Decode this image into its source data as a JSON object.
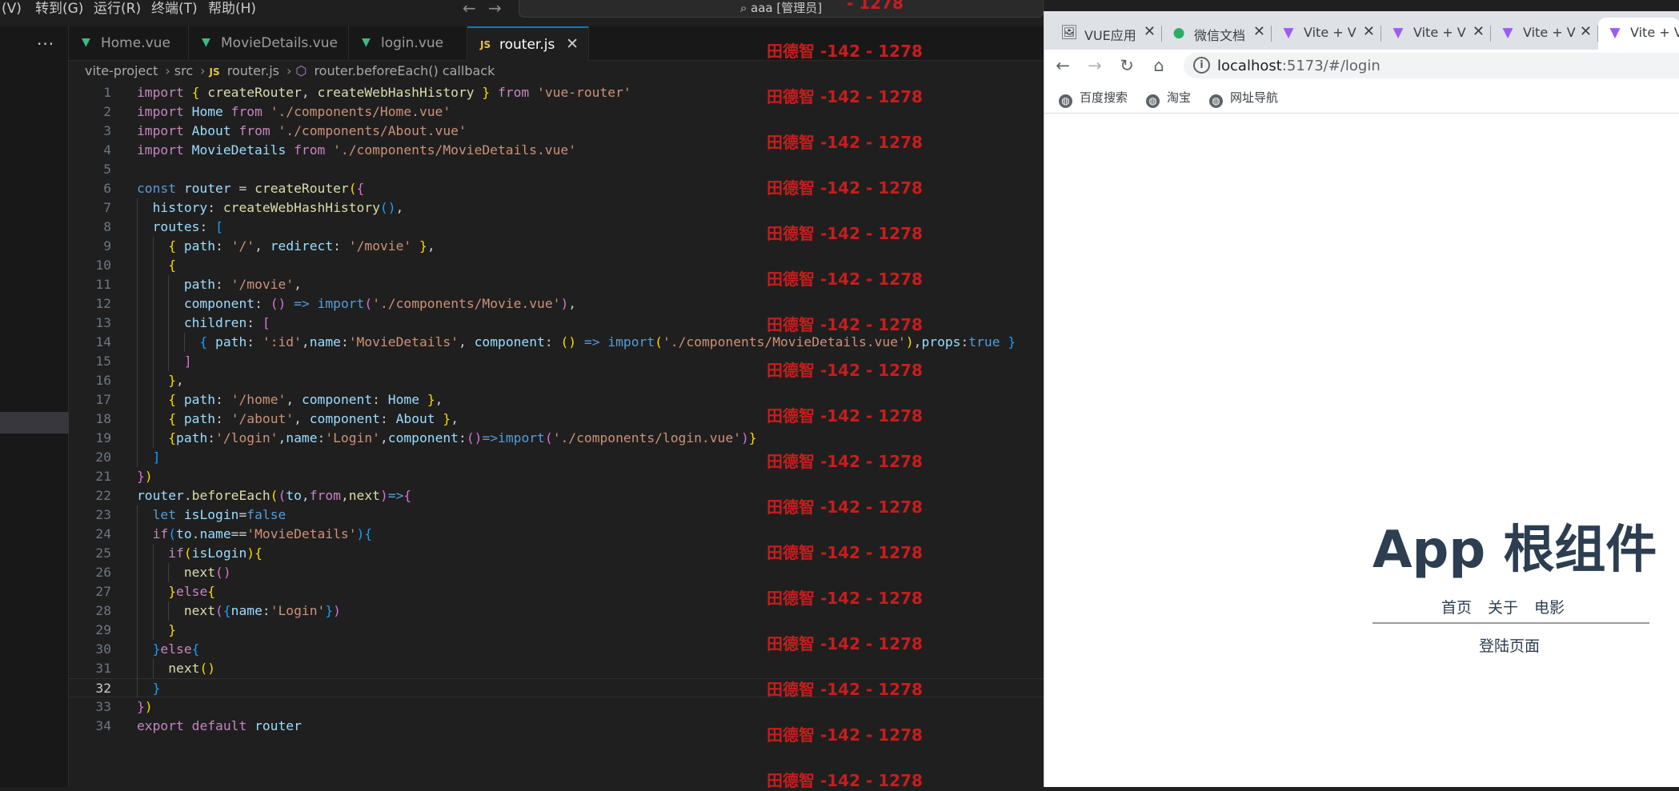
{
  "titlebar": {
    "menus": [
      "(V)",
      "转到(G)",
      "运行(R)",
      "终端(T)",
      "帮助(H)"
    ],
    "back_arrow": "←",
    "forward_arrow": "→",
    "command_center": "aaa [管理员]"
  },
  "sidebar": {
    "more": "···"
  },
  "editor_tabs": [
    {
      "label": "Home.vue",
      "icon": "vue-icon",
      "active": false
    },
    {
      "label": "MovieDetails.vue",
      "icon": "vue-icon",
      "active": false
    },
    {
      "label": "login.vue",
      "icon": "vue-icon",
      "active": false
    },
    {
      "label": "router.js",
      "icon": "js-icon",
      "active": true
    }
  ],
  "tab_icons": {
    "vue": "▼",
    "js": "JS",
    "close": "✕"
  },
  "breadcrumb": {
    "project": "vite-project",
    "folder": "src",
    "file": "router.js",
    "symbol": "router.beforeEach() callback",
    "separator": "›"
  },
  "code": {
    "current_line": 32,
    "lines": [
      "import { createRouter, createWebHashHistory } from 'vue-router'",
      "import Home from './components/Home.vue'",
      "import About from './components/About.vue'",
      "import MovieDetails from './components/MovieDetails.vue'",
      "",
      "const router = createRouter({",
      "  history: createWebHashHistory(),",
      "  routes: [",
      "    { path: '/', redirect: '/movie' },",
      "    {",
      "      path: '/movie',",
      "      component: () => import('./components/Movie.vue'),",
      "      children: [",
      "        { path: ':id',name:'MovieDetails', component: () => import('./components/MovieDetails.vue'),props:true }",
      "      ]",
      "    },",
      "    { path: '/home', component: Home },",
      "    { path: '/about', component: About },",
      "    {path:'/login',name:'Login',component:()=>import('./components/login.vue')}",
      "  ]",
      "})",
      "router.beforeEach((to,from,next)=>{",
      "  let isLogin=false",
      "  if(to.name=='MovieDetails'){",
      "    if(isLogin){",
      "      next()",
      "    }else{",
      "      next({name:'Login'})",
      "    }",
      "  }else{",
      "    next()",
      "  }",
      "})",
      "export default router"
    ]
  },
  "watermark": {
    "text": "田德智 -142 - 1278",
    "top_partial": "- 1278",
    "count": 17,
    "color": "#c81d1d"
  },
  "browser": {
    "tabs": [
      {
        "label": "VUE应用",
        "icon": "picture-icon"
      },
      {
        "label": "微信文档",
        "icon": "wechat-icon"
      },
      {
        "label": "Vite + V",
        "icon": "vite-icon"
      },
      {
        "label": "Vite + V",
        "icon": "vite-icon"
      },
      {
        "label": "Vite + V",
        "icon": "vite-icon"
      },
      {
        "label": "Vite + V",
        "icon": "vite-icon",
        "active": true
      }
    ],
    "tab_close": "✕",
    "icons": {
      "back": "←",
      "forward": "→",
      "reload": "↻",
      "home": "⌂",
      "info": "i",
      "globe": "◍"
    },
    "url_host": "localhost",
    "url_rest": ":5173/#/login",
    "bookmarks": [
      "百度搜索",
      "淘宝",
      "网址导航"
    ]
  },
  "app": {
    "title": "App 根组件",
    "nav": [
      "首页",
      "关于",
      "电影"
    ],
    "subtitle": "登陆页面"
  },
  "colors": {
    "editor_bg": "#1f1f1f",
    "accent": "#0078d4",
    "vue_green": "#41b883",
    "watermark_red": "#c81d1d",
    "app_text": "#2c3e50"
  }
}
